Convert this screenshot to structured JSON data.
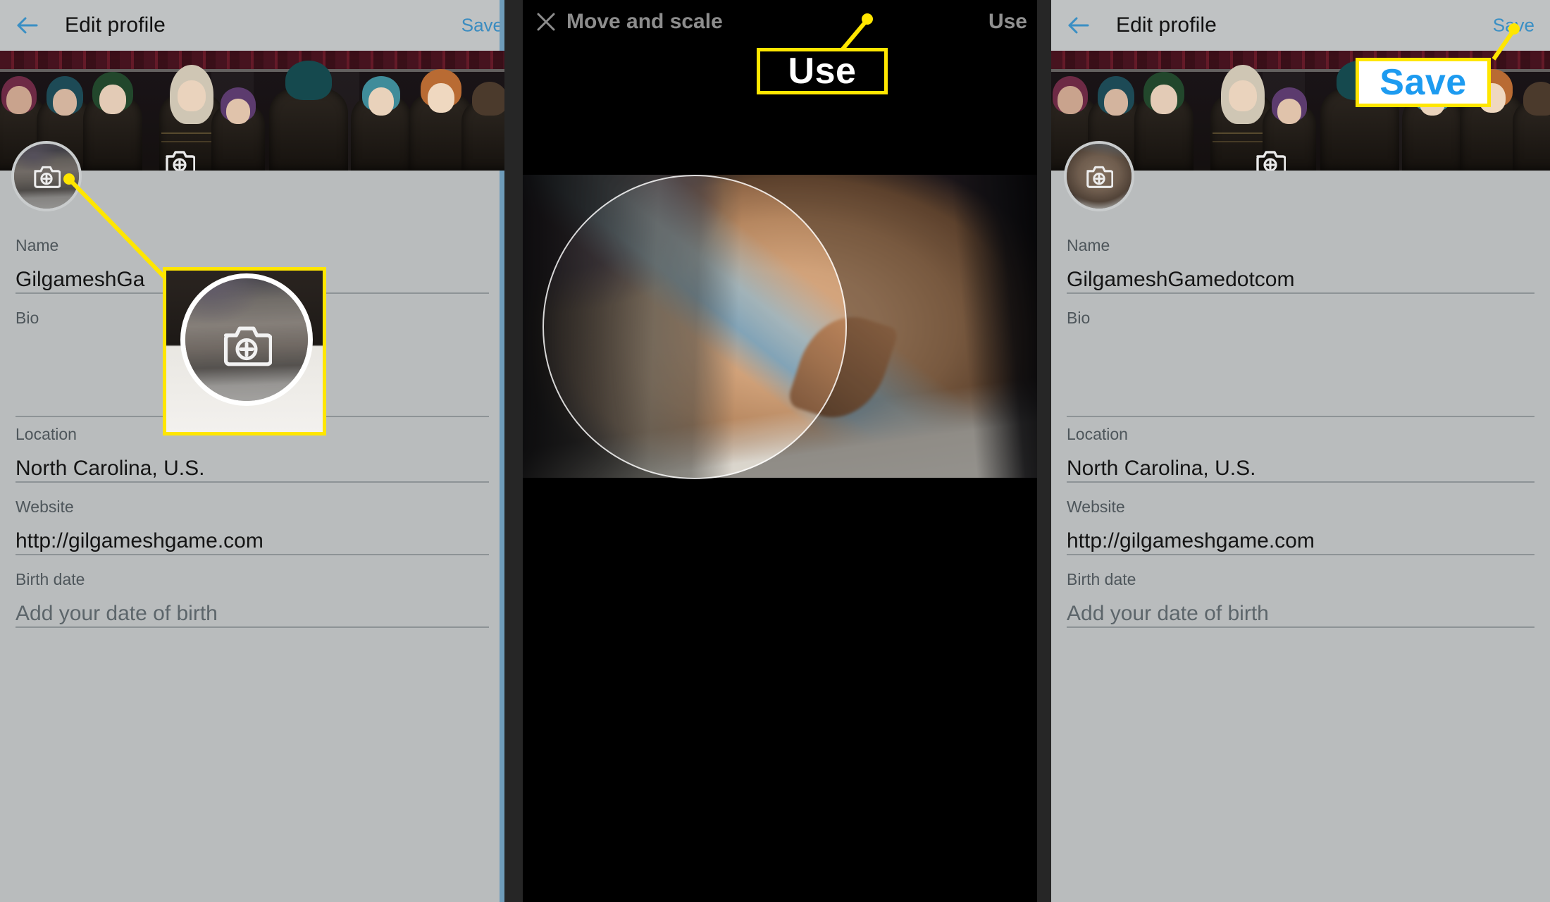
{
  "panels": {
    "left": {
      "appbar": {
        "back_icon": "back-arrow-icon",
        "title": "Edit profile",
        "save_label": "Save"
      },
      "banner": {
        "camera_icon": "add-photo-camera-icon"
      },
      "avatar": {
        "camera_icon": "add-photo-camera-icon"
      },
      "fields": [
        {
          "label": "Name",
          "value": "GilgameshGa",
          "placeholder": false
        },
        {
          "label": "Bio",
          "value": "",
          "placeholder": false
        },
        {
          "label": "Location",
          "value": "North Carolina, U.S.",
          "placeholder": false
        },
        {
          "label": "Website",
          "value": "http://gilgameshgame.com",
          "placeholder": false
        },
        {
          "label": "Birth date",
          "value": "Add your date of birth",
          "placeholder": true
        }
      ],
      "callout": {
        "type": "zoomed-avatar",
        "camera_icon": "add-photo-camera-icon"
      }
    },
    "middle": {
      "appbar": {
        "close_icon": "close-x-icon",
        "title": "Move and scale",
        "use_label": "Use"
      },
      "photo": {
        "subject": "sleeping-orange-cat-photo",
        "crop_shape": "circle"
      },
      "callout": {
        "label": "Use"
      }
    },
    "right": {
      "appbar": {
        "back_icon": "back-arrow-icon",
        "title": "Edit profile",
        "save_label": "Save"
      },
      "banner": {
        "camera_icon": "add-photo-camera-icon"
      },
      "avatar": {
        "camera_icon": "add-photo-camera-icon"
      },
      "fields": [
        {
          "label": "Name",
          "value": "GilgameshGamedotcom",
          "placeholder": false
        },
        {
          "label": "Bio",
          "value": "",
          "placeholder": false
        },
        {
          "label": "Location",
          "value": "North Carolina, U.S.",
          "placeholder": false
        },
        {
          "label": "Website",
          "value": "http://gilgameshgame.com",
          "placeholder": false
        },
        {
          "label": "Birth date",
          "value": "Add your date of birth",
          "placeholder": true
        }
      ],
      "callout": {
        "label": "Save"
      }
    }
  },
  "colors": {
    "annotation_yellow": "#ffe600",
    "link_blue": "#3a8fc4",
    "twitter_blue": "#1d9bf0",
    "panel_bg": "#b9bcbd",
    "appbar_bg": "#bfc2c3",
    "label_gray": "#4e565b",
    "gutter": "#262626"
  }
}
